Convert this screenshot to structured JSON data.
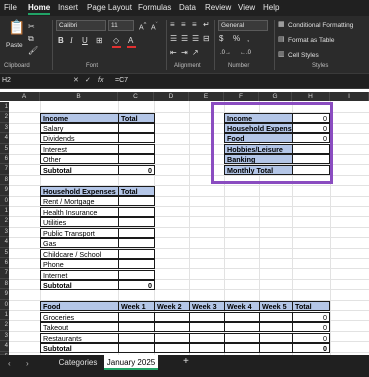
{
  "menu": {
    "tabs": [
      "File",
      "Home",
      "Insert",
      "Page Layout",
      "Formulas",
      "Data",
      "Review",
      "View",
      "Help"
    ],
    "active": "Home"
  },
  "ribbon": {
    "clipboard": {
      "paste_label": "Paste",
      "group_label": "Clipboard"
    },
    "font": {
      "font_name": "Calibri",
      "font_size": "11",
      "group_label": "Font"
    },
    "alignment": {
      "group_label": "Alignment"
    },
    "number": {
      "format": "General",
      "currency": "$",
      "percent": "%",
      "comma": ",",
      "group_label": "Number"
    },
    "styles": {
      "conditional_formatting": "Conditional Formatting",
      "format_as_table": "Format as Table",
      "cell_styles": "Cell Styles",
      "group_label": "Styles"
    }
  },
  "formula_bar": {
    "name_box": "H2",
    "formula": "=C7"
  },
  "columns": [
    "A",
    "B",
    "C",
    "D",
    "E",
    "F",
    "G",
    "H",
    "I"
  ],
  "rows": [
    "1",
    "2",
    "3",
    "4",
    "5",
    "6",
    "7",
    "8",
    "9",
    "0",
    "1",
    "2",
    "3",
    "4",
    "5",
    "6",
    "7",
    "8",
    "9",
    "0",
    "1",
    "2",
    "3",
    "4",
    "5",
    "6"
  ],
  "income_table": {
    "headers": [
      "Income",
      "Total"
    ],
    "rows": [
      [
        "Salary",
        ""
      ],
      [
        "Dividends",
        ""
      ],
      [
        "Interest",
        ""
      ],
      [
        "Other",
        ""
      ]
    ],
    "subtotal": [
      "Subtotal",
      "0"
    ]
  },
  "household_table": {
    "headers": [
      "Household Expenses",
      "Total"
    ],
    "rows": [
      [
        "Rent / Mortgage",
        ""
      ],
      [
        "Health Insurance",
        ""
      ],
      [
        "Utilities",
        ""
      ],
      [
        "Public Transport",
        ""
      ],
      [
        "Gas",
        ""
      ],
      [
        "Childcare / School",
        ""
      ],
      [
        "Phone",
        ""
      ],
      [
        "Internet",
        ""
      ]
    ],
    "subtotal": [
      "Subtotal",
      "0"
    ]
  },
  "summary_table": {
    "rows": [
      [
        "Income",
        "0"
      ],
      [
        "Household Expenses",
        "0"
      ],
      [
        "Food",
        "0"
      ],
      [
        "Hobbies/Leisure",
        ""
      ],
      [
        "Banking",
        ""
      ],
      [
        "Monthly Total",
        ""
      ]
    ]
  },
  "food_table": {
    "headers": [
      "Food",
      "Week 1",
      "Week 2",
      "Week 3",
      "Week 4",
      "Week 5",
      "Total"
    ],
    "rows": [
      [
        "Groceries",
        "0"
      ],
      [
        "Takeout",
        "0"
      ],
      [
        "Restaurants",
        "0"
      ]
    ],
    "subtotal": [
      "Subtotal",
      "0"
    ]
  },
  "sheet_tabs": {
    "tabs": [
      "Categories",
      "January 2025"
    ],
    "active": "January 2025",
    "add": "+"
  },
  "colors": {
    "accent": "#21a366",
    "table_header": "#b4c6e7",
    "highlight": "#8a4cc0"
  }
}
